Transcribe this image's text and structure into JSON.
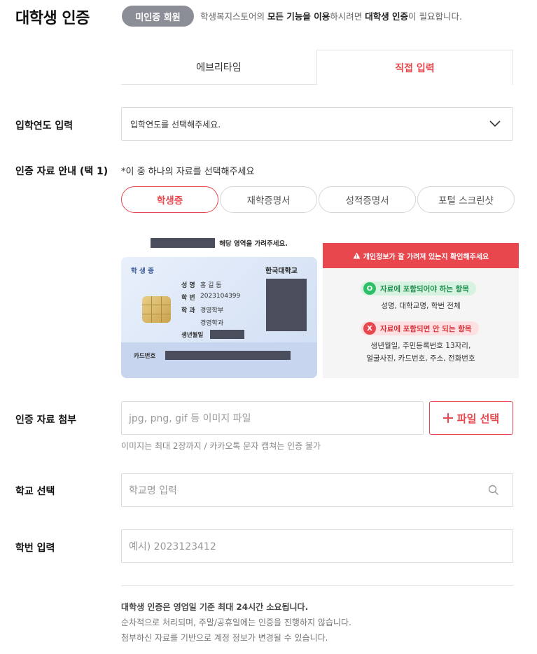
{
  "header": {
    "title": "대학생 인증",
    "badge": "미인증 회원",
    "desc_prefix": "학생복지스토어의 ",
    "desc_bold1": "모든 기능을 이용",
    "desc_mid": "하시려면 ",
    "desc_bold2": "대학생 인증",
    "desc_suffix": "이 필요합니다."
  },
  "tabs": [
    {
      "label": "에브리타임",
      "active": false
    },
    {
      "label": "직접 입력",
      "active": true
    }
  ],
  "admission_year": {
    "label": "입학연도 입력",
    "placeholder": "입학연도를 선택해주세요."
  },
  "documents": {
    "label": "인증 자료 안내 (택 1)",
    "hint": "*이 중 하나의 자료를 선택해주세요",
    "options": [
      {
        "label": "학생증",
        "selected": true
      },
      {
        "label": "재학증명서",
        "selected": false
      },
      {
        "label": "성적증명서",
        "selected": false
      },
      {
        "label": "포털 스크린샷",
        "selected": false
      }
    ]
  },
  "sample_card": {
    "cover_note": "해당 영역을 가려주세요.",
    "card_title": "학 생 증",
    "university": "한국대학교",
    "name_label": "성  명",
    "name_value": "홍 길 동",
    "id_label": "학  번",
    "id_value": "2023104399",
    "dept_label": "학  과",
    "dept_value1": "경영학부",
    "dept_value2": "경영학과",
    "birth_label": "생년월일",
    "card_no_label": "카드번호"
  },
  "warning": {
    "header": "개인정보가 잘 가려져 있는지 확인해주세요",
    "include_mark": "O",
    "include_title": "자료에 포함되어야 하는 항목",
    "include_items": "성명, 대학교명, 학번 전체",
    "exclude_mark": "X",
    "exclude_title": "자료에 포함되면 안 되는 항목",
    "exclude_items_1": "생년월일, 주민등록번호 13자리,",
    "exclude_items_2": "얼굴사진, 카드번호, 주소, 전화번호",
    "colors": {
      "header": "#e9474e",
      "include": "#2cbf6a",
      "exclude": "#e9474e"
    }
  },
  "attachment": {
    "label": "인증 자료 첨부",
    "placeholder": "jpg, png, gif 등 이미지 파일",
    "button": "파일 선택",
    "button_icon": "plus-icon",
    "note": "이미지는 최대 2장까지 / 카카오톡 문자 캡쳐는 인증 불가"
  },
  "school": {
    "label": "학교 선택",
    "placeholder": "학교명 입력",
    "icon": "search-icon"
  },
  "student_id": {
    "label": "학번 입력",
    "placeholder": "예시) 2023123412"
  },
  "notice": {
    "line1": "대학생 인증은 영업일 기준 최대 24시간 소요됩니다.",
    "line2": "순차적으로 처리되며, 주말/공휴일에는 인증을 진행하지 않습니다.",
    "line3": "첨부하신 자료를 기반으로 계정 정보가 변경될 수 있습니다."
  },
  "accent_color": "#e8484e"
}
